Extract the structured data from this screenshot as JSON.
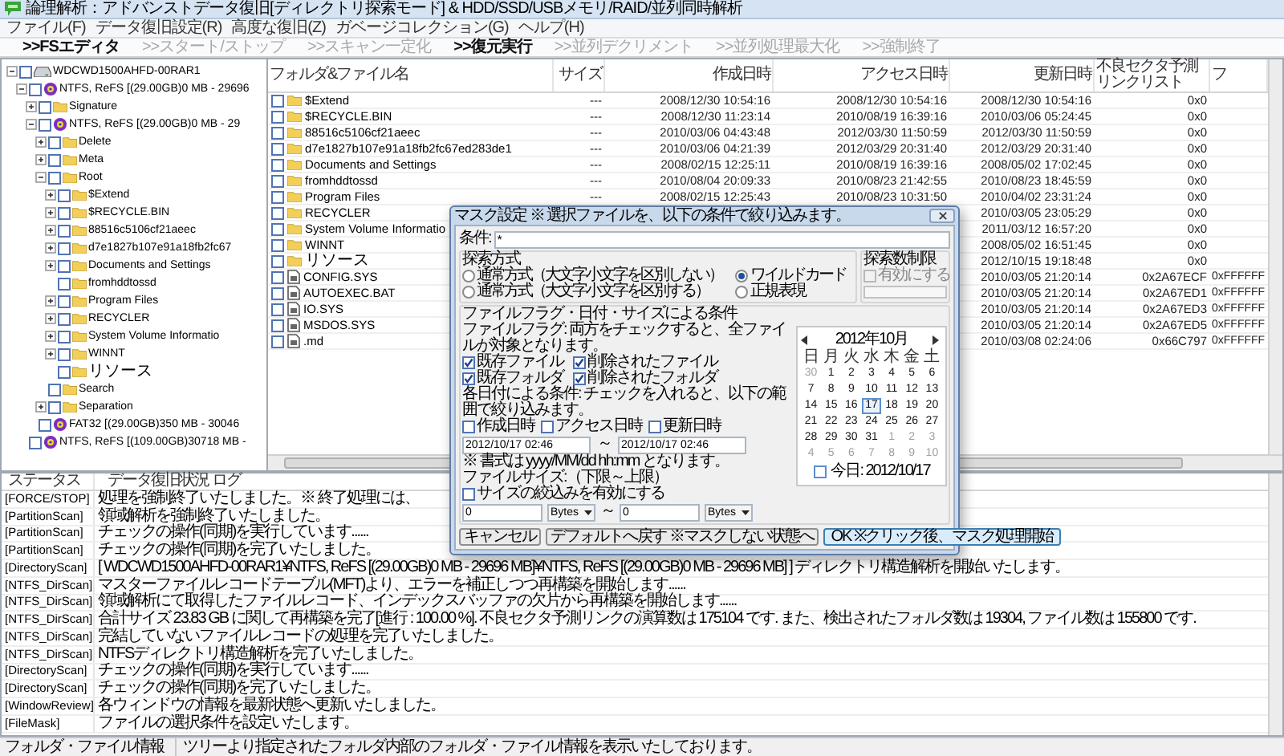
{
  "window": {
    "title": "論理解析：アドバンストデータ復旧[ディレクトリ探索モード] & HDD/SSD/USBメモリ/RAID/並列同時解析"
  },
  "menu": [
    "ファイル(F)",
    "データ復旧設定(R)",
    "高度な復旧(Z)",
    "ガベージコレクション(G)",
    "ヘルプ(H)"
  ],
  "toolbar": [
    {
      "label": ">>FSエディタ",
      "disabled": false
    },
    {
      "label": ">>スタート/ストップ",
      "disabled": true
    },
    {
      "label": ">>スキャン一定化",
      "disabled": true
    },
    {
      "label": ">>復元実行",
      "disabled": false
    },
    {
      "label": ">>並列デクリメント",
      "disabled": true
    },
    {
      "label": ">>並列処理最大化",
      "disabled": true
    },
    {
      "label": ">>強制終了",
      "disabled": true
    }
  ],
  "tree": [
    {
      "label": "WDCWD1500AHFD-00RAR1",
      "kind": "drive",
      "expanded": true,
      "checked": false,
      "children": [
        {
          "label": "NTFS, ReFS [(29.00GB)0 MB - 29696",
          "kind": "partition",
          "expanded": true,
          "checked": false,
          "children": [
            {
              "label": "Signature",
              "kind": "folder",
              "expanded": false,
              "checked": false
            },
            {
              "label": "NTFS, ReFS [(29.00GB)0 MB - 29",
              "kind": "partition",
              "expanded": true,
              "checked": false,
              "children": [
                {
                  "label": "Delete",
                  "kind": "folder",
                  "expanded": false,
                  "checked": false
                },
                {
                  "label": "Meta",
                  "kind": "folder",
                  "expanded": false,
                  "checked": false
                },
                {
                  "label": "Root",
                  "kind": "folder",
                  "expanded": true,
                  "checked": false,
                  "children": [
                    {
                      "label": "$Extend",
                      "kind": "folder",
                      "expanded": false,
                      "checked": false
                    },
                    {
                      "label": "$RECYCLE.BIN",
                      "kind": "folder",
                      "expanded": false,
                      "checked": false
                    },
                    {
                      "label": "88516c5106cf21aeec",
                      "kind": "folder",
                      "expanded": false,
                      "checked": false
                    },
                    {
                      "label": "d7e1827b107e91a18fb2fc67",
                      "kind": "folder",
                      "expanded": false,
                      "checked": false
                    },
                    {
                      "label": "Documents and Settings",
                      "kind": "folder",
                      "expanded": false,
                      "checked": false
                    },
                    {
                      "label": "fromhddtossd",
                      "kind": "folder",
                      "checked": false
                    },
                    {
                      "label": "Program Files",
                      "kind": "folder",
                      "expanded": false,
                      "checked": false
                    },
                    {
                      "label": "RECYCLER",
                      "kind": "folder",
                      "expanded": false,
                      "checked": false
                    },
                    {
                      "label": "System Volume Informatio",
                      "kind": "folder",
                      "expanded": false,
                      "checked": false
                    },
                    {
                      "label": "WINNT",
                      "kind": "folder",
                      "expanded": false,
                      "checked": false
                    },
                    {
                      "label": "リソース",
                      "kind": "folder",
                      "checked": false
                    }
                  ]
                },
                {
                  "label": "Search",
                  "kind": "folder",
                  "checked": false
                },
                {
                  "label": "Separation",
                  "kind": "folder",
                  "expanded": false,
                  "checked": false
                }
              ]
            },
            {
              "label": "FAT32 [(29.00GB)350 MB - 30046",
              "kind": "partition",
              "checked": false
            }
          ]
        },
        {
          "label": "NTFS, ReFS [(109.00GB)30718 MB -",
          "kind": "partition",
          "checked": false
        }
      ]
    }
  ],
  "file_list": {
    "columns": [
      "フォルダ&ファイル名",
      "サイズ",
      "作成日時",
      "アクセス日時",
      "更新日時",
      "不良セクタ予測リンクリスト",
      "フ"
    ],
    "rows": [
      {
        "kind": "folder",
        "checked": false,
        "cells": [
          "$Extend",
          "---",
          "2008/12/30 10:54:16",
          "2008/12/30 10:54:16",
          "2008/12/30 10:54:16",
          "0x0",
          null
        ]
      },
      {
        "kind": "folder",
        "checked": false,
        "cells": [
          "$RECYCLE.BIN",
          "---",
          "2008/12/30 11:23:14",
          "2010/08/19 16:39:16",
          "2010/03/06 05:24:45",
          "0x0",
          null
        ]
      },
      {
        "kind": "folder",
        "checked": false,
        "cells": [
          "88516c5106cf21aeec",
          "---",
          "2010/03/06 04:43:48",
          "2012/03/30 11:50:59",
          "2012/03/30 11:50:59",
          "0x0",
          null
        ]
      },
      {
        "kind": "folder",
        "checked": false,
        "cells": [
          "d7e1827b107e91a18fb2fc67ed283de1",
          "---",
          "2010/03/06 04:21:39",
          "2012/03/29 20:31:40",
          "2012/03/29 20:31:40",
          "0x0",
          null
        ]
      },
      {
        "kind": "folder",
        "checked": false,
        "cells": [
          "Documents and Settings",
          "---",
          "2008/02/15 12:25:11",
          "2010/08/19 16:39:16",
          "2008/05/02 17:02:45",
          "0x0",
          null
        ]
      },
      {
        "kind": "folder",
        "checked": false,
        "cells": [
          "fromhddtossd",
          "---",
          "2010/08/04 20:09:33",
          "2010/08/23 21:42:55",
          "2010/08/23 18:45:59",
          "0x0",
          null
        ]
      },
      {
        "kind": "folder",
        "checked": false,
        "cells": [
          "Program Files",
          "---",
          "2008/02/15 12:25:43",
          "2010/08/23 10:31:50",
          "2010/04/02 23:31:24",
          "0x0",
          null
        ]
      },
      {
        "kind": "folder",
        "checked": false,
        "cells": [
          "RECYCLER",
          null,
          null,
          null,
          "2010/03/05 23:05:29",
          "0x0",
          null
        ]
      },
      {
        "kind": "folder",
        "checked": false,
        "cells": [
          "System Volume Informatio",
          null,
          null,
          null,
          "2011/03/12 16:57:20",
          "0x0",
          null
        ]
      },
      {
        "kind": "folder",
        "checked": false,
        "cells": [
          "WINNT",
          null,
          null,
          null,
          "2008/05/02 16:51:45",
          "0x0",
          null
        ]
      },
      {
        "kind": "folder",
        "checked": false,
        "cells": [
          "リソース",
          null,
          null,
          null,
          "2012/10/15 19:18:48",
          "0x0",
          null
        ]
      },
      {
        "kind": "file",
        "checked": false,
        "cells": [
          "CONFIG.SYS",
          null,
          null,
          null,
          "2010/03/05 21:20:14",
          "0x2A67ECF",
          "0xFFFFFF"
        ]
      },
      {
        "kind": "file",
        "checked": false,
        "cells": [
          "AUTOEXEC.BAT",
          null,
          null,
          null,
          "2010/03/05 21:20:14",
          "0x2A67ED1",
          "0xFFFFFF"
        ]
      },
      {
        "kind": "file",
        "checked": false,
        "cells": [
          "IO.SYS",
          null,
          null,
          null,
          "2010/03/05 21:20:14",
          "0x2A67ED3",
          "0xFFFFFF"
        ]
      },
      {
        "kind": "file",
        "checked": false,
        "cells": [
          "MSDOS.SYS",
          null,
          null,
          null,
          "2010/03/05 21:20:14",
          "0x2A67ED5",
          "0xFFFFFF"
        ]
      },
      {
        "kind": "file",
        "checked": false,
        "cells": [
          ".md",
          null,
          null,
          null,
          "2010/03/08 02:24:06",
          "0x66C797",
          "0xFFFFFF"
        ]
      }
    ]
  },
  "log": {
    "columns": [
      "ステータス",
      "データ復旧状況 ログ"
    ],
    "rows": [
      {
        "status": "[FORCE/STOP]",
        "message": "処理を強制終了いたしました。※ 終了処理には、"
      },
      {
        "status": "[PartitionScan]",
        "message": "領域解析を強制終了いたしました。"
      },
      {
        "status": "[PartitionScan]",
        "message": "チェックの操作(同期)を実行しています......"
      },
      {
        "status": "[PartitionScan]",
        "message": "チェックの操作(同期)を完了いたしました。"
      },
      {
        "status": "[DirectoryScan]",
        "message": "[ WDCWD1500AHFD-00RAR1¥NTFS, ReFS [(29.00GB)0 MB - 29696 MB]¥NTFS, ReFS [(29.00GB)0 MB - 29696 MB] ] ディレクトリ構造解析を開始いたします。"
      },
      {
        "status": "[NTFS_DirScan]",
        "message": "マスターファイルレコードテーブル(MFT)より、エラーを補正しつつ再構築を開始します......"
      },
      {
        "status": "[NTFS_DirScan]",
        "message": "領域解析にて取得したファイルレコード、インデックスバッファの欠片から再構築を開始します......"
      },
      {
        "status": "[NTFS_DirScan]",
        "message": "合計サイズ 23.83 GB に関して再構築を完了[進行 : 100.00 %]. 不良セクタ予測リンクの演算数は 175104 です. また、検出されたフォルダ数は 19304, ファイル数は 155800 です."
      },
      {
        "status": "[NTFS_DirScan]",
        "message": "完結していないファイルレコードの処理を完了いたしました。"
      },
      {
        "status": "[NTFS_DirScan]",
        "message": "NTFSディレクトリ構造解析を完了いたしました。"
      },
      {
        "status": "[DirectoryScan]",
        "message": "チェックの操作(同期)を実行しています......"
      },
      {
        "status": "[DirectoryScan]",
        "message": "チェックの操作(同期)を完了いたしました。"
      },
      {
        "status": "[WindowReview]",
        "message": "各ウィンドウの情報を最新状態へ更新いたしました。"
      },
      {
        "status": "[FileMask]",
        "message": "ファイルの選択条件を設定いたします。"
      }
    ]
  },
  "status_bar": [
    "フォルダ・ファイル情報",
    "ツリーより指定されたフォルダ内部のフォルダ・ファイル情報を表示いたしております。"
  ],
  "dialog": {
    "title": "マスク設定 ※ 選択ファイルを、以下の条件で絞り込みます。",
    "condition_label": "条件:",
    "condition_value": "*",
    "search_mode": {
      "title": "探索方式",
      "options": [
        {
          "label": "通常方式（大文字小文字を区別しない）",
          "selected": false
        },
        {
          "label": "ワイルドカード",
          "selected": true
        },
        {
          "label": "通常方式（大文字小文字を区別する）",
          "selected": false
        },
        {
          "label": "正規表現",
          "selected": false
        }
      ]
    },
    "search_limit": {
      "title": "探索数制限",
      "label": "有効にする",
      "checked": false,
      "disabled": true
    },
    "conditions": {
      "title": "ファイルフラグ・日付・サイズによる条件",
      "flag_note": "ファイルフラグ: 両方をチェックすると、全ファイルが対象となります。",
      "flags": [
        {
          "label": "既存ファイル",
          "checked": true
        },
        {
          "label": "削除されたファイル",
          "checked": true
        },
        {
          "label": "既存フォルダ",
          "checked": true
        },
        {
          "label": "削除されたフォルダ",
          "checked": true
        }
      ],
      "date_note": "各日付による条件: チェックを入れると、以下の範囲で絞り込みます。",
      "date_flags": [
        {
          "label": "作成日時",
          "checked": false
        },
        {
          "label": "アクセス日時",
          "checked": false
        },
        {
          "label": "更新日時",
          "checked": false
        }
      ],
      "date_from": "2012/10/17 02:46",
      "date_range_sep": "～",
      "date_to": "2012/10/17 02:46",
      "format_note": "※ 書式は yyyy/MM/dd hh:mm となります。",
      "size_label": "ファイルサイズ:（下限～上限）",
      "size_filter": {
        "label": "サイズの絞込みを有効にする",
        "checked": false
      },
      "size_from": "0",
      "size_from_unit": "Bytes",
      "size_range_sep": "～",
      "size_to": "0",
      "size_to_unit": "Bytes"
    },
    "calendar": {
      "month": "2012年10月",
      "weekdays": [
        "日",
        "月",
        "火",
        "水",
        "木",
        "金",
        "土"
      ],
      "days": [
        {
          "label": "30",
          "other_month": true,
          "selected": false
        },
        {
          "label": "1",
          "other_month": false,
          "selected": false
        },
        {
          "label": "2",
          "other_month": false,
          "selected": false
        },
        {
          "label": "3",
          "other_month": false,
          "selected": false
        },
        {
          "label": "4",
          "other_month": false,
          "selected": false
        },
        {
          "label": "5",
          "other_month": false,
          "selected": false
        },
        {
          "label": "6",
          "other_month": false,
          "selected": false
        },
        {
          "label": "7",
          "other_month": false,
          "selected": false
        },
        {
          "label": "8",
          "other_month": false,
          "selected": false
        },
        {
          "label": "9",
          "other_month": false,
          "selected": false
        },
        {
          "label": "10",
          "other_month": false,
          "selected": false
        },
        {
          "label": "11",
          "other_month": false,
          "selected": false
        },
        {
          "label": "12",
          "other_month": false,
          "selected": false
        },
        {
          "label": "13",
          "other_month": false,
          "selected": false
        },
        {
          "label": "14",
          "other_month": false,
          "selected": false
        },
        {
          "label": "15",
          "other_month": false,
          "selected": false
        },
        {
          "label": "16",
          "other_month": false,
          "selected": false
        },
        {
          "label": "17",
          "other_month": false,
          "selected": true
        },
        {
          "label": "18",
          "other_month": false,
          "selected": false
        },
        {
          "label": "19",
          "other_month": false,
          "selected": false
        },
        {
          "label": "20",
          "other_month": false,
          "selected": false
        },
        {
          "label": "21",
          "other_month": false,
          "selected": false
        },
        {
          "label": "22",
          "other_month": false,
          "selected": false
        },
        {
          "label": "23",
          "other_month": false,
          "selected": false
        },
        {
          "label": "24",
          "other_month": false,
          "selected": false
        },
        {
          "label": "25",
          "other_month": false,
          "selected": false
        },
        {
          "label": "26",
          "other_month": false,
          "selected": false
        },
        {
          "label": "27",
          "other_month": false,
          "selected": false
        },
        {
          "label": "28",
          "other_month": false,
          "selected": false
        },
        {
          "label": "29",
          "other_month": false,
          "selected": false
        },
        {
          "label": "30",
          "other_month": false,
          "selected": false
        },
        {
          "label": "31",
          "other_month": false,
          "selected": false
        },
        {
          "label": "1",
          "other_month": true,
          "selected": false
        },
        {
          "label": "2",
          "other_month": true,
          "selected": false
        },
        {
          "label": "3",
          "other_month": true,
          "selected": false
        },
        {
          "label": "4",
          "other_month": true,
          "selected": false
        },
        {
          "label": "5",
          "other_month": true,
          "selected": false
        },
        {
          "label": "6",
          "other_month": true,
          "selected": false
        },
        {
          "label": "7",
          "other_month": true,
          "selected": false
        },
        {
          "label": "8",
          "other_month": true,
          "selected": false
        },
        {
          "label": "9",
          "other_month": true,
          "selected": false
        },
        {
          "label": "10",
          "other_month": true,
          "selected": false
        }
      ],
      "today": "今日: 2012/10/17"
    },
    "buttons": [
      {
        "label": "キャンセル",
        "primary": false
      },
      {
        "label": "デフォルトへ戻す ※マスクしない状態へ",
        "primary": false
      },
      {
        "label": "OK ※クリック後、マスク処理開始",
        "primary": true
      }
    ]
  }
}
